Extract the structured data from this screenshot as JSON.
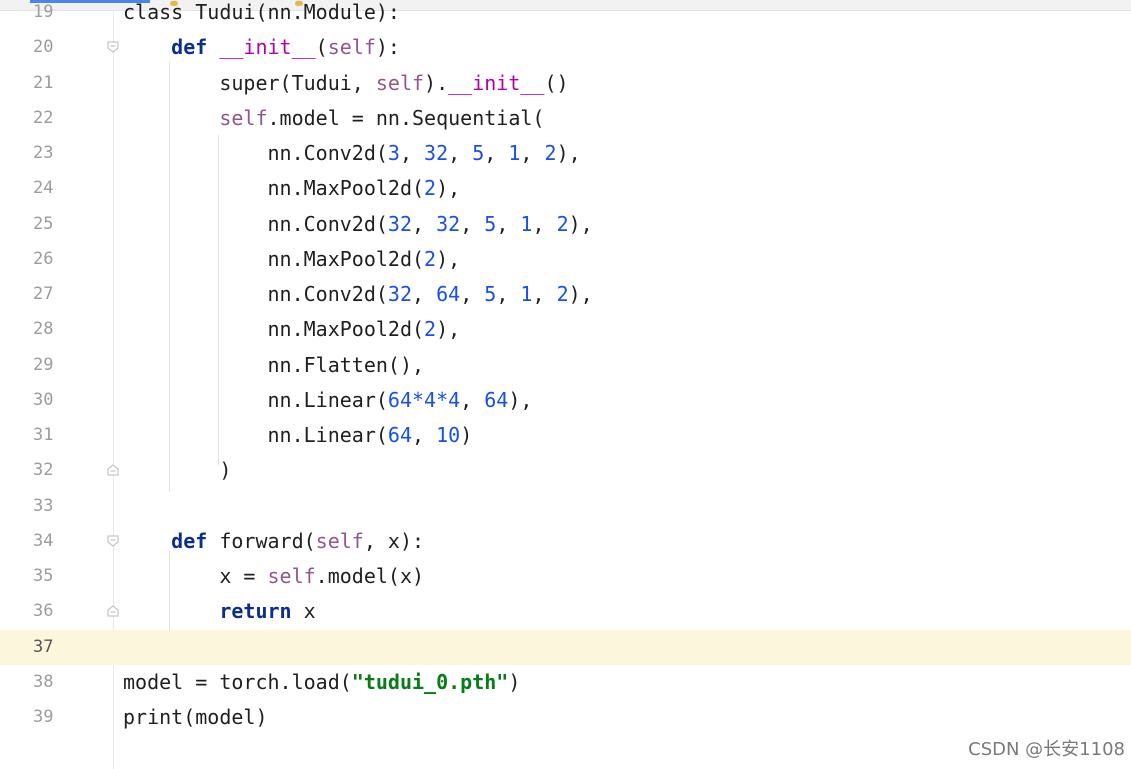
{
  "editor": {
    "lines": [
      {
        "number": "19",
        "tokens": [
          {
            "t": "class Tudui(nn.Module):",
            "c": ""
          }
        ]
      },
      {
        "number": "20",
        "tokens": [
          {
            "t": "    ",
            "c": ""
          },
          {
            "t": "def",
            "c": "kw"
          },
          {
            "t": " ",
            "c": ""
          },
          {
            "t": "__init__",
            "c": "magic"
          },
          {
            "t": "(",
            "c": ""
          },
          {
            "t": "self",
            "c": "self"
          },
          {
            "t": "):",
            "c": ""
          }
        ]
      },
      {
        "number": "21",
        "tokens": [
          {
            "t": "        super(Tudui, ",
            "c": ""
          },
          {
            "t": "self",
            "c": "self"
          },
          {
            "t": ").",
            "c": ""
          },
          {
            "t": "__init__",
            "c": "magic"
          },
          {
            "t": "()",
            "c": ""
          }
        ]
      },
      {
        "number": "22",
        "tokens": [
          {
            "t": "        ",
            "c": ""
          },
          {
            "t": "self",
            "c": "self"
          },
          {
            "t": ".model = nn.Sequential(",
            "c": ""
          }
        ]
      },
      {
        "number": "23",
        "tokens": [
          {
            "t": "            nn.Conv2d(",
            "c": ""
          },
          {
            "t": "3",
            "c": "num"
          },
          {
            "t": ", ",
            "c": ""
          },
          {
            "t": "32",
            "c": "num"
          },
          {
            "t": ", ",
            "c": ""
          },
          {
            "t": "5",
            "c": "num"
          },
          {
            "t": ", ",
            "c": ""
          },
          {
            "t": "1",
            "c": "num"
          },
          {
            "t": ", ",
            "c": ""
          },
          {
            "t": "2",
            "c": "num"
          },
          {
            "t": "),",
            "c": ""
          }
        ]
      },
      {
        "number": "24",
        "tokens": [
          {
            "t": "            nn.MaxPool2d(",
            "c": ""
          },
          {
            "t": "2",
            "c": "num"
          },
          {
            "t": "),",
            "c": ""
          }
        ]
      },
      {
        "number": "25",
        "tokens": [
          {
            "t": "            nn.Conv2d(",
            "c": ""
          },
          {
            "t": "32",
            "c": "num"
          },
          {
            "t": ", ",
            "c": ""
          },
          {
            "t": "32",
            "c": "num"
          },
          {
            "t": ", ",
            "c": ""
          },
          {
            "t": "5",
            "c": "num"
          },
          {
            "t": ", ",
            "c": ""
          },
          {
            "t": "1",
            "c": "num"
          },
          {
            "t": ", ",
            "c": ""
          },
          {
            "t": "2",
            "c": "num"
          },
          {
            "t": "),",
            "c": ""
          }
        ]
      },
      {
        "number": "26",
        "tokens": [
          {
            "t": "            nn.MaxPool2d(",
            "c": ""
          },
          {
            "t": "2",
            "c": "num"
          },
          {
            "t": "),",
            "c": ""
          }
        ]
      },
      {
        "number": "27",
        "tokens": [
          {
            "t": "            nn.Conv2d(",
            "c": ""
          },
          {
            "t": "32",
            "c": "num"
          },
          {
            "t": ", ",
            "c": ""
          },
          {
            "t": "64",
            "c": "num"
          },
          {
            "t": ", ",
            "c": ""
          },
          {
            "t": "5",
            "c": "num"
          },
          {
            "t": ", ",
            "c": ""
          },
          {
            "t": "1",
            "c": "num"
          },
          {
            "t": ", ",
            "c": ""
          },
          {
            "t": "2",
            "c": "num"
          },
          {
            "t": "),",
            "c": ""
          }
        ]
      },
      {
        "number": "28",
        "tokens": [
          {
            "t": "            nn.MaxPool2d(",
            "c": ""
          },
          {
            "t": "2",
            "c": "num"
          },
          {
            "t": "),",
            "c": ""
          }
        ]
      },
      {
        "number": "29",
        "tokens": [
          {
            "t": "            nn.Flatten(),",
            "c": ""
          }
        ]
      },
      {
        "number": "30",
        "tokens": [
          {
            "t": "            nn.Linear(",
            "c": ""
          },
          {
            "t": "64*4*4",
            "c": "num"
          },
          {
            "t": ", ",
            "c": ""
          },
          {
            "t": "64",
            "c": "num"
          },
          {
            "t": "),",
            "c": ""
          }
        ]
      },
      {
        "number": "31",
        "tokens": [
          {
            "t": "            nn.Linear(",
            "c": ""
          },
          {
            "t": "64",
            "c": "num"
          },
          {
            "t": ", ",
            "c": ""
          },
          {
            "t": "10",
            "c": "num"
          },
          {
            "t": ")",
            "c": ""
          }
        ]
      },
      {
        "number": "32",
        "tokens": [
          {
            "t": "        )",
            "c": ""
          }
        ]
      },
      {
        "number": "33",
        "tokens": []
      },
      {
        "number": "34",
        "tokens": [
          {
            "t": "    ",
            "c": ""
          },
          {
            "t": "def",
            "c": "kw"
          },
          {
            "t": " forward(",
            "c": ""
          },
          {
            "t": "self",
            "c": "self"
          },
          {
            "t": ", x):",
            "c": ""
          }
        ]
      },
      {
        "number": "35",
        "tokens": [
          {
            "t": "        x = ",
            "c": ""
          },
          {
            "t": "self",
            "c": "self"
          },
          {
            "t": ".model(x)",
            "c": ""
          }
        ]
      },
      {
        "number": "36",
        "tokens": [
          {
            "t": "        ",
            "c": ""
          },
          {
            "t": "return",
            "c": "kw"
          },
          {
            "t": " x",
            "c": ""
          }
        ]
      },
      {
        "number": "37",
        "tokens": []
      },
      {
        "number": "38",
        "tokens": [
          {
            "t": "model = torch.load(",
            "c": ""
          },
          {
            "t": "\"tudui_0.pth\"",
            "c": "str"
          },
          {
            "t": ")",
            "c": ""
          }
        ]
      },
      {
        "number": "39",
        "tokens": [
          {
            "t": "print(model)",
            "c": ""
          }
        ]
      }
    ],
    "current_line": "37"
  },
  "watermark": "CSDN @长安1108",
  "colors": {
    "keyword": "#0b2f8a",
    "self": "#94558d",
    "number": "#1750eb",
    "string": "#067d17",
    "current_line_bg": "#fcf7dc"
  }
}
